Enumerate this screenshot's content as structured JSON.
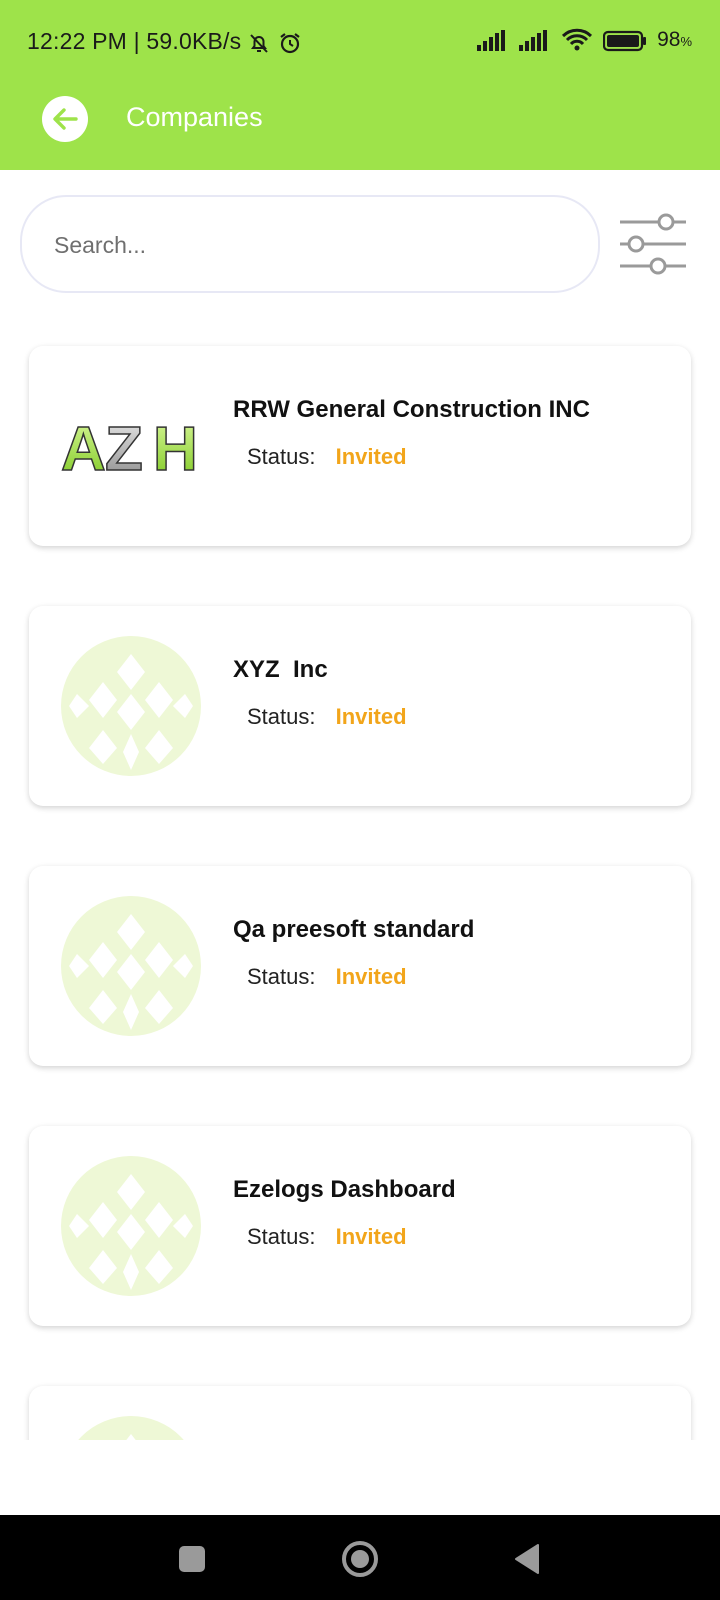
{
  "status_bar": {
    "time_speed": "12:22 PM | 59.0KB/s",
    "battery_pct": "98",
    "battery_pct_sign": "%"
  },
  "appbar": {
    "title": "Companies",
    "back_icon": "arrow-left-icon"
  },
  "search": {
    "placeholder": "Search...",
    "value": ""
  },
  "filter_icon": "sliders-icon",
  "companies": [
    {
      "name": "RRW General Construction INC",
      "status_label": "Status:",
      "status": "Invited",
      "logo": "azh-logo"
    },
    {
      "name": "XYZ  Inc",
      "status_label": "Status:",
      "status": "Invited",
      "logo": "placeholder-pattern"
    },
    {
      "name": "Qa preesoft standard",
      "status_label": "Status:",
      "status": "Invited",
      "logo": "placeholder-pattern"
    },
    {
      "name": "Ezelogs Dashboard",
      "status_label": "Status:",
      "status": "Invited",
      "logo": "placeholder-pattern"
    },
    {
      "name": "",
      "status_label": "",
      "status": "",
      "logo": "placeholder-pattern"
    }
  ],
  "logo_text": "AZH",
  "colors": {
    "header": "#9ee34a",
    "status_invited": "#f2a51a",
    "placeholder_pattern": "#eef8d6"
  },
  "navbar": {
    "recent_icon": "square-icon",
    "home_icon": "circle-home-icon",
    "back_icon": "triangle-back-icon"
  }
}
